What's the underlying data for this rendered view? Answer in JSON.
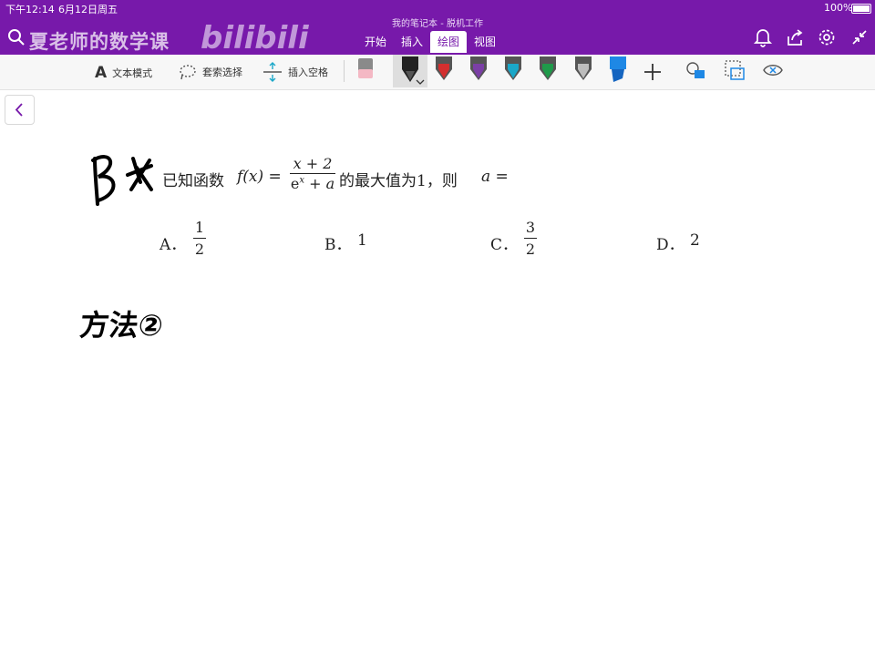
{
  "status_bar": {
    "time": "下午12:14",
    "date": "6月12日周五",
    "battery": "100%"
  },
  "document": {
    "title": "我的笔记本 - 脱机工作"
  },
  "watermark": {
    "channel": "夏老师的数学课",
    "logo": "bilibili"
  },
  "tabs": [
    {
      "label": "开始",
      "active": false
    },
    {
      "label": "插入",
      "active": false
    },
    {
      "label": "绘图",
      "active": true
    },
    {
      "label": "视图",
      "active": false
    }
  ],
  "toolbar": {
    "text_mode": "文本模式",
    "lasso_select": "套索选择",
    "insert_space": "插入空格",
    "pens": [
      {
        "name": "black-pen",
        "color": "#222222",
        "selected": true
      },
      {
        "name": "red-pen",
        "color": "#d32f2f",
        "selected": false
      },
      {
        "name": "purple-pen",
        "color": "#7b3fa6",
        "selected": false
      },
      {
        "name": "cyan-pen",
        "color": "#1aa7c8",
        "selected": false
      },
      {
        "name": "green-pen",
        "color": "#1f9a4a",
        "selected": false
      },
      {
        "name": "gray-pen",
        "color": "#9a9a9a",
        "selected": false
      },
      {
        "name": "blue-highlighter",
        "color": "#1e88e5",
        "selected": false
      }
    ]
  },
  "question": {
    "handwritten_answer": "B",
    "prefix": "已知函数",
    "func": "f(x) =",
    "numerator": "x + 2",
    "denominator_base": "e",
    "denominator_exp": "x",
    "denominator_rest": " + a",
    "suffix": "的最大值为1，则",
    "unknown": "a =",
    "choices": {
      "a_label": "A．",
      "a_num": "1",
      "a_den": "2",
      "b_label": "B．",
      "b_value": "1",
      "c_label": "C．",
      "c_num": "3",
      "c_den": "2",
      "d_label": "D．",
      "d_value": "2"
    }
  },
  "handwritten_note": "方法②",
  "colors": {
    "accent": "#7719aa",
    "ink": "#000000"
  }
}
